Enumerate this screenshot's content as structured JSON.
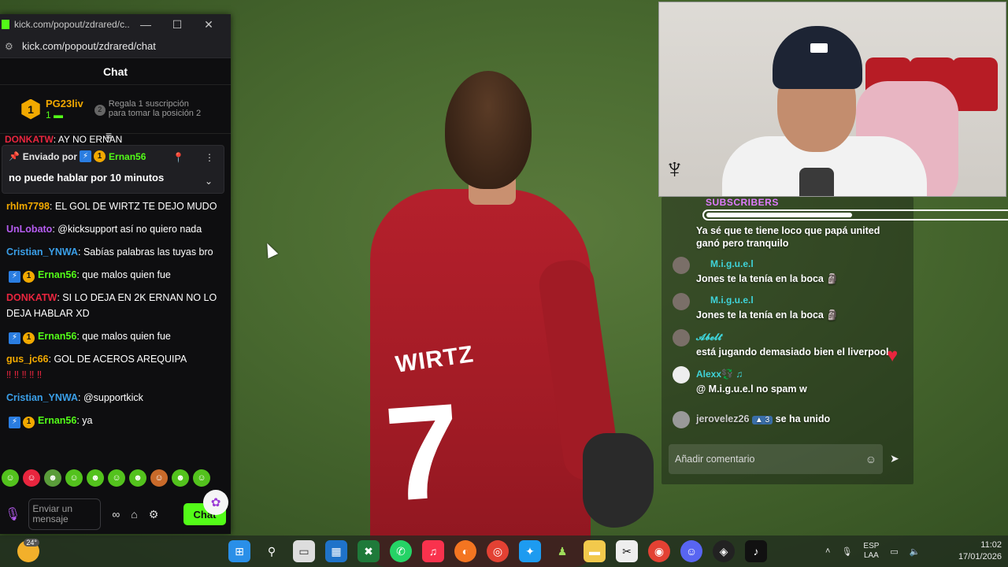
{
  "browser": {
    "window_title": "kick.com/popout/zdrared/c...",
    "url": "kick.com/popout/zdrared/chat",
    "minimize": "—",
    "maximize": "☐",
    "close": "✕"
  },
  "chat": {
    "header": "Chat",
    "leaderboard": {
      "rank": "1",
      "user": "PG23liv",
      "count": "1",
      "gift_rank": "2",
      "gift_text": "Regala 1 suscripción para tomar la posición 2"
    },
    "cut_message": {
      "user": "DONKATW",
      "text": ": AY NO ERNAN"
    },
    "pinned": {
      "prefix": "Enviado por",
      "user": "Ernan56",
      "message": "no puede hablar por 10 minutos"
    },
    "messages": [
      {
        "user": "rhlm7798",
        "color": "#f2a900",
        "text": ": EL GOL DE WIRTZ TE DEJO MUDO",
        "badges": false
      },
      {
        "user": "UnLobato",
        "color": "#b55cf0",
        "text": ": @kicksupport así no quiero nada",
        "badges": false
      },
      {
        "user": "Cristian_YNWA",
        "color": "#3a9fe8",
        "text": ": Sabías palabras las tuyas bro",
        "badges": false
      },
      {
        "user": "Ernan56",
        "color": "#53fc18",
        "text": ": que malos quien fue",
        "badges": true
      },
      {
        "user": "DONKATW",
        "color": "#e8253e",
        "text": ": SI LO DEJA EN 2K ERNAN NO LO DEJA HABLAR XD",
        "badges": false
      },
      {
        "user": "Ernan56",
        "color": "#53fc18",
        "text": ": que malos quien fue",
        "badges": true
      },
      {
        "user": "gus_jc66",
        "color": "#f2a900",
        "text": ": GOL DE ACEROS AREQUIPA",
        "badges": false,
        "extra": "‼ ‼ ‼ ‼ ‼"
      },
      {
        "user": "Cristian_YNWA",
        "color": "#3a9fe8",
        "text": ": @supportkick",
        "badges": false
      },
      {
        "user": "Ernan56",
        "color": "#53fc18",
        "text": ": ya",
        "badges": true
      }
    ],
    "input_placeholder": "Enviar un mensaje",
    "send_button": "Chat"
  },
  "stream": {
    "shirt_name": "WIRTZ",
    "shirt_number": "7"
  },
  "overlay": {
    "subscribers_label": "SUBSCRIBERS",
    "subscribers_progress": 0.43,
    "messages": [
      {
        "user": "",
        "text": "Ya sé que te tiene loco que papá united ganó pero tranquilo"
      },
      {
        "user": "M.i.g.u.e.l",
        "text": "Jones te la tenía en la boca 🗿"
      },
      {
        "user": "M.i.g.u.e.l",
        "text": "Jones te la tenía en la boca 🗿"
      },
      {
        "user": "𝓐𝓫𝓮𝓵𝓽",
        "text": "está jugando demasiado bien el liverpool"
      },
      {
        "user": "Alexx💱 ♫",
        "text": "@  M.i.g.u.e.l  no spam w"
      },
      {
        "user": "jerovelez26",
        "text": "se ha unido",
        "level": "3"
      }
    ],
    "input_placeholder": "Añadir comentario"
  },
  "taskbar": {
    "weather_temp": "24°",
    "lang_top": "ESP",
    "lang_bottom": "LAA",
    "time": "11:02",
    "date": "17/01/2026"
  }
}
